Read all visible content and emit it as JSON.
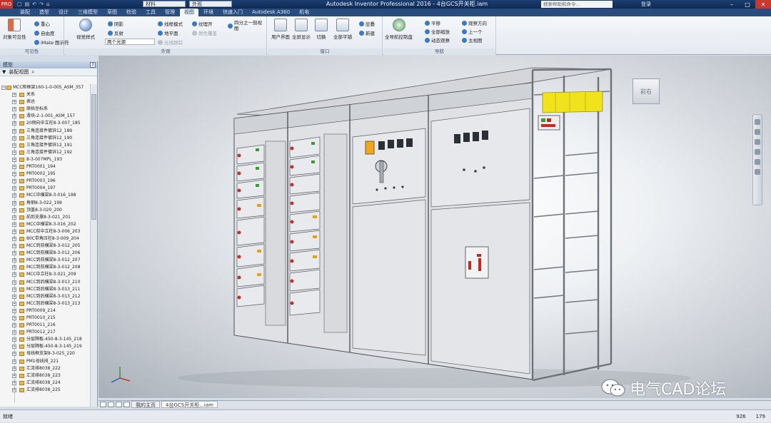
{
  "titlebar": {
    "app_button": "PRO",
    "qat_items": [
      "□",
      "▤",
      "↶",
      "↷",
      "⌂"
    ],
    "material": "材料",
    "appearance": "外观",
    "title": "Autodesk Inventor Professional 2016 - 4台GCS开关柜.iam",
    "search_placeholder": "搜索帮助和命令...",
    "user": "登录"
  },
  "tabs": [
    "装配",
    "造型",
    "设计",
    "三维模型",
    "草图",
    "检验",
    "工具",
    "管理",
    "视图",
    "环境",
    "快速入门",
    "Autodesk A360",
    "机电"
  ],
  "active_tab": "视图",
  "ribbon": {
    "g1": {
      "title": "可见性",
      "big": "对象可见性",
      "items": [
        "重心",
        "自由度",
        "iMate 图示符"
      ]
    },
    "g2": {
      "title": "外观",
      "big": "视觉样式",
      "items": [
        "阴影",
        "反射",
        "两个光源"
      ],
      "items2": [
        "线框模式",
        "地平面",
        "光线跟踪"
      ],
      "items3": [
        "纹理开",
        "颜色覆盖",
        "四分之一剖视图"
      ],
      "combo": "两个光源"
    },
    "g3": {
      "title": "窗口",
      "items": [
        "用户界面",
        "全屏显示",
        "切换",
        "全部平铺",
        "层叠",
        "新建"
      ]
    },
    "g4": {
      "title": "导航",
      "big": "全导航控制盘",
      "items": [
        "平移",
        "全部缩放",
        "动态观察"
      ],
      "items2": [
        "观察方向",
        "上一个",
        "主视图"
      ]
    }
  },
  "browser": {
    "title": "模型",
    "toolbar": "装配视图",
    "help": "?",
    "root": "MCC柜框架160-1-0-005_ASM_357",
    "items": [
      "关系",
      "表达",
      "原始坐标系",
      "滑块-2-1-001_ASM_157",
      "20侧向中立柱8-3-007_185",
      "三角连接件镀锌12_189",
      "三角连接件镀锌12_190",
      "三角连接件镀锌12_191",
      "三角连接件镀锌12_192",
      "8-3-007MPL_193",
      "PRT0001_194",
      "PRT0002_195",
      "PRT0003_196",
      "PRT0004_197",
      "MCC中横梁8-3-016_198",
      "角钢8-3-022_199",
      "顶盖8-3-020_200",
      "前后支撑8-3-021_201",
      "MCC中横梁8-3-016_202",
      "MCC前中立柱8-3-006_203",
      "80C带角压柱8-3-009_204",
      "MCC到前横梁8-3-012_205",
      "MCC到前横梁8-3-012_206",
      "MCC到前横梁8-3-012_207",
      "MCC到前横梁8-3-012_208",
      "MCC中立柱8-3-021_209",
      "MCC到后横梁8-3-013_210",
      "MCC到后横梁8-3-013_211",
      "MCC到后横梁8-3-013_212",
      "MCC到后横梁8-3-013_213",
      "PRT0009_214",
      "PRT0010_215",
      "PRT0011_216",
      "PRT0012_217",
      "分层隔板-450-8-3-145_218",
      "分层隔板-450-8-3-145_219",
      "母线框支架8-3-025_220",
      "PM1母线排_221",
      "汇流排8038_222",
      "汇流排8038_223",
      "汇流排8038_224",
      "汇流排8038_225"
    ]
  },
  "viewport": {
    "viewcube_label": "前右",
    "watermark": "电气CAD论坛"
  },
  "doctabs": [
    "我的主页",
    "4台GCS开关柜...iam"
  ],
  "status": {
    "text": "就绪",
    "x": "926",
    "y": "179"
  }
}
